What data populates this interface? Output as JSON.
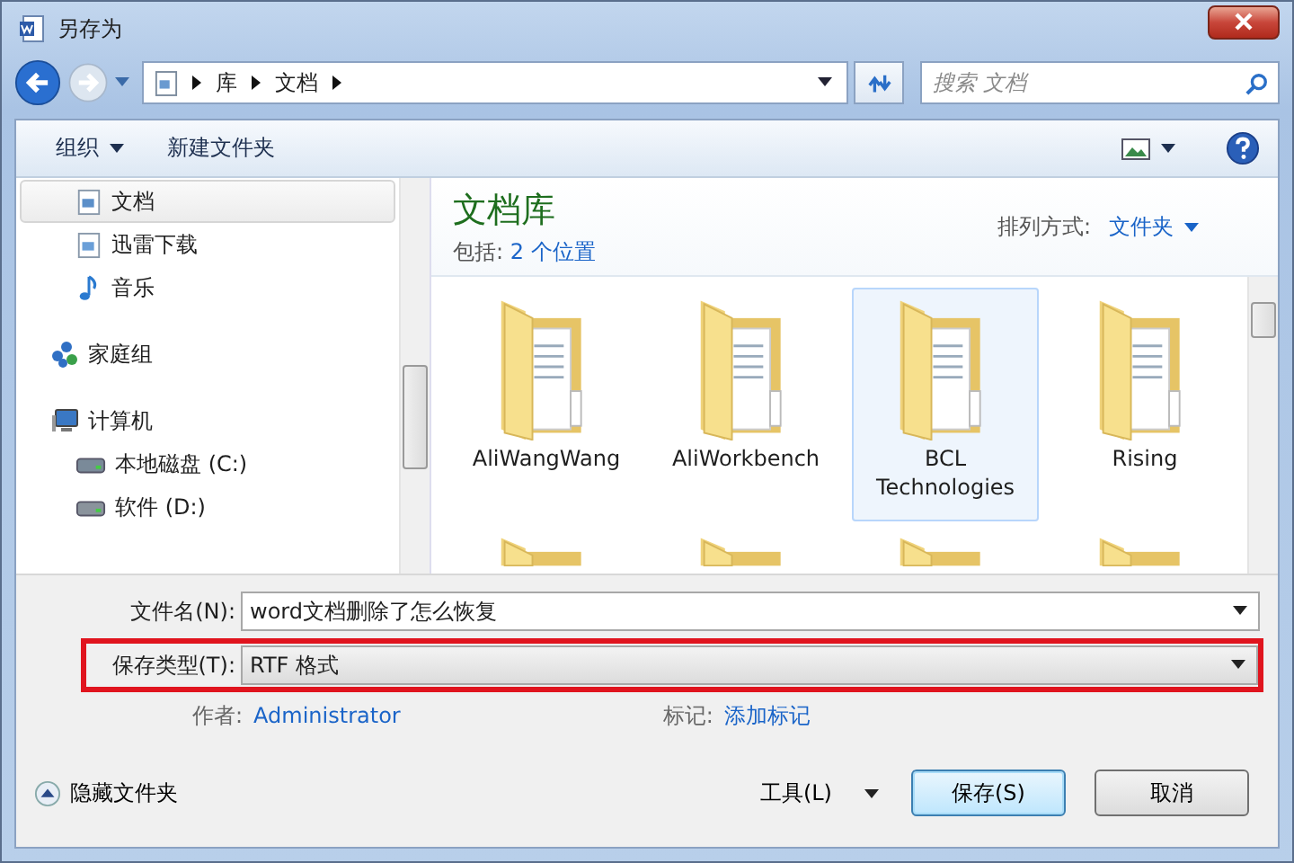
{
  "window": {
    "title": "另存为"
  },
  "address": {
    "crumbs": [
      "库",
      "文档"
    ],
    "search_placeholder": "搜索 文档"
  },
  "toolbar": {
    "organize": "组织",
    "new_folder": "新建文件夹"
  },
  "sidebar": {
    "library_items": [
      {
        "label": "文档",
        "kind": "document",
        "selected": true
      },
      {
        "label": "迅雷下载",
        "kind": "download",
        "selected": false
      },
      {
        "label": "音乐",
        "kind": "music",
        "selected": false
      }
    ],
    "items": [
      {
        "label": "家庭组",
        "kind": "homegroup",
        "selected": false
      },
      {
        "label": "计算机",
        "kind": "computer",
        "selected": false,
        "children": [
          {
            "label": "本地磁盘 (C:)",
            "kind": "system-drive",
            "selected": false
          },
          {
            "label": "软件 (D:)",
            "kind": "drive",
            "selected": false
          }
        ]
      }
    ]
  },
  "library": {
    "title": "文档库",
    "includes_label": "包括:",
    "includes_link": "2 个位置",
    "arrange_label": "排列方式:",
    "arrange_value": "文件夹"
  },
  "folders": [
    {
      "label": "AliWangWang",
      "selected": false
    },
    {
      "label": "AliWorkbench",
      "selected": false
    },
    {
      "label": "BCL Technologies",
      "selected": true
    },
    {
      "label": "Rising",
      "selected": false
    }
  ],
  "form": {
    "filename_label": "文件名(N):",
    "filename": "word文档删除了怎么恢复",
    "type_label": "保存类型(T):",
    "type": "RTF 格式",
    "type_highlighted": true,
    "author_label": "作者:",
    "author": "Administrator",
    "tags_label": "标记:",
    "tags": "添加标记"
  },
  "footer": {
    "hide_folders": "隐藏文件夹",
    "tools": "工具(L)",
    "save": "保存(S)",
    "cancel": "取消"
  }
}
